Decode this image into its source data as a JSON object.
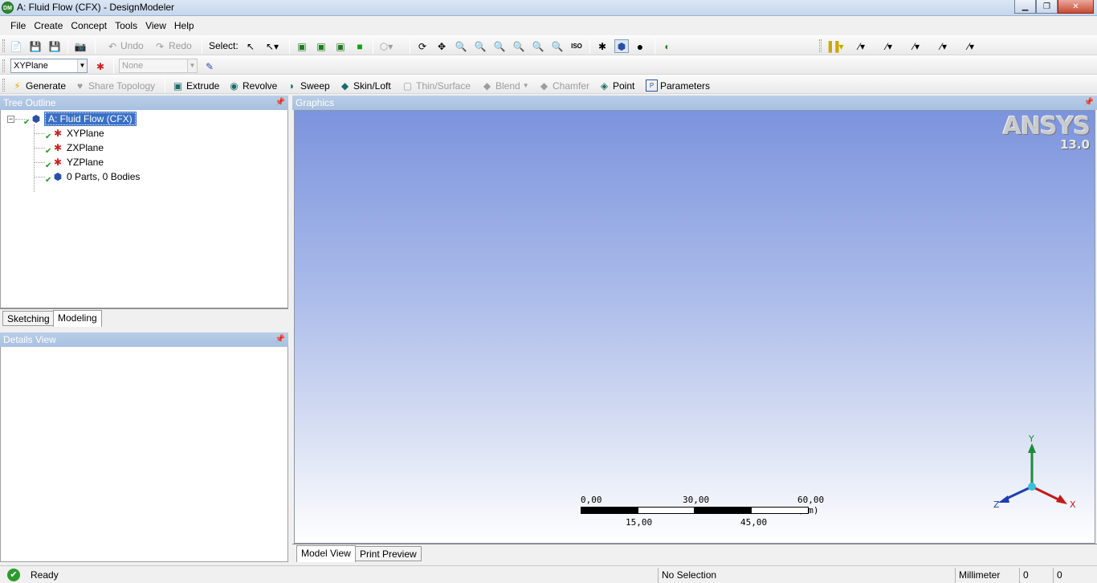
{
  "window": {
    "title": "A: Fluid Flow (CFX) - DesignModeler",
    "app_icon_text": "DM"
  },
  "menu": [
    "File",
    "Create",
    "Concept",
    "Tools",
    "View",
    "Help"
  ],
  "toolbar1": {
    "undo_label": "Undo",
    "redo_label": "Redo",
    "select_label": "Select:"
  },
  "toolbar2": {
    "plane_value": "XYPlane",
    "sketch_value": "None"
  },
  "toolbar3": {
    "generate": "Generate",
    "share_topology": "Share Topology",
    "extrude": "Extrude",
    "revolve": "Revolve",
    "sweep": "Sweep",
    "skin_loft": "Skin/Loft",
    "thin_surface": "Thin/Surface",
    "blend": "Blend",
    "chamfer": "Chamfer",
    "point": "Point",
    "parameters": "Parameters"
  },
  "tree": {
    "header": "Tree Outline",
    "root": "A: Fluid Flow (CFX)",
    "items": [
      "XYPlane",
      "ZXPlane",
      "YZPlane",
      "0 Parts, 0 Bodies"
    ],
    "tabs": [
      "Sketching",
      "Modeling"
    ]
  },
  "details": {
    "header": "Details View"
  },
  "graphics": {
    "header": "Graphics",
    "logo_brand": "ANSYS",
    "logo_version": "13.0",
    "scale": {
      "top_labels": [
        "0,00",
        "30,00",
        "60,00 (mm)"
      ],
      "bottom_labels": [
        "15,00",
        "45,00"
      ]
    },
    "axes": {
      "x": "X",
      "y": "Y",
      "z": "Z"
    },
    "tabs": [
      "Model View",
      "Print Preview"
    ]
  },
  "status": {
    "message": "Ready",
    "selection": "No Selection",
    "units": "Millimeter",
    "value1": "0",
    "value2": "0"
  },
  "colors": {
    "panel_header": "#a8c0e0",
    "viewport_top": "#7c94dd",
    "selection": "#3a6fc6"
  }
}
